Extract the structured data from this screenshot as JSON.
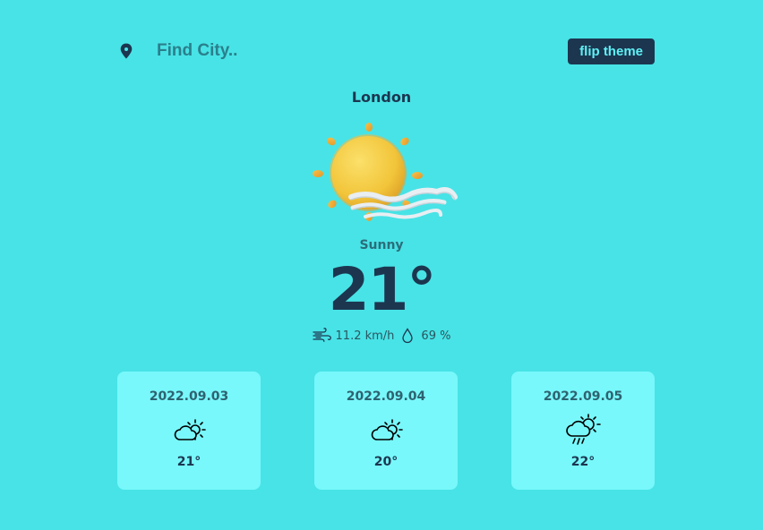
{
  "search": {
    "placeholder": "Find City..",
    "value": ""
  },
  "theme_button": {
    "label": "flip theme"
  },
  "current": {
    "city": "London",
    "condition": "Sunny",
    "temperature": "21°",
    "wind": "11.2 km/h",
    "humidity": "69 %",
    "icon": "sun-with-wind-icon"
  },
  "forecast": [
    {
      "date": "2022.09.03",
      "temp": "21°",
      "icon": "partly-cloudy-icon"
    },
    {
      "date": "2022.09.04",
      "temp": "20°",
      "icon": "partly-cloudy-icon"
    },
    {
      "date": "2022.09.05",
      "temp": "22°",
      "icon": "sun-cloud-rain-icon"
    }
  ],
  "colors": {
    "background": "#48e3e6",
    "card": "#78f8fb",
    "dark": "#1c3650",
    "accent": "#5ef1f5"
  }
}
